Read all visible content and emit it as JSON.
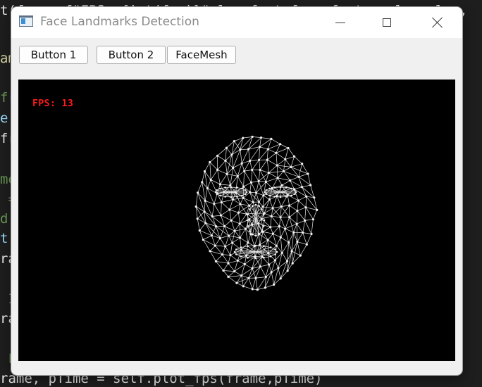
{
  "background_code": {
    "lines": [
      {
        "spans": [
          {
            "text": "t(frame,f\"FPS: {int(fps)}\",loc,font_face,font_scale,color,",
            "cls": "c-white"
          }
        ]
      },
      {
        "spans": [
          {
            "text": "am",
            "cls": "c-yellow"
          }
        ]
      },
      {
        "spans": [
          {
            "text": "fr",
            "cls": "c-green"
          }
        ]
      },
      {
        "spans": [
          {
            "text": "e:",
            "cls": "c-cyan"
          }
        ]
      },
      {
        "spans": [
          {
            "text": "fr",
            "cls": "c-white"
          }
        ]
      },
      {
        "spans": [
          {
            "text": "me",
            "cls": "c-green"
          }
        ]
      },
      {
        "spans": [
          {
            "text": " =",
            "cls": "c-green"
          }
        ]
      },
      {
        "spans": [
          {
            "text": "d",
            "cls": "c-green"
          }
        ]
      },
      {
        "spans": [
          {
            "text": "t:",
            "cls": "c-cyan"
          }
        ]
      },
      {
        "spans": [
          {
            "text": "ra",
            "cls": "c-white"
          }
        ]
      },
      {
        "spans": [
          {
            "text": " I",
            "cls": "c-green"
          }
        ]
      },
      {
        "spans": [
          {
            "text": "ra",
            "cls": "c-white"
          }
        ]
      },
      {
        "spans": [
          {
            "text": " F",
            "cls": "c-green"
          }
        ]
      },
      {
        "spans": [
          {
            "text": "rame, pTime = self.plot_fps(frame,pTime)",
            "cls": "c-white"
          }
        ]
      }
    ]
  },
  "window": {
    "title": "Face Landmarks Detection",
    "icon": "app-window-icon",
    "controls": {
      "minimize": "minimize-icon",
      "maximize": "maximize-icon",
      "close": "close-icon"
    }
  },
  "toolbar": {
    "button1_label": "Button 1",
    "button2_label": "Button 2",
    "button3_label": "FaceMesh"
  },
  "video": {
    "fps_text": "FPS: 13",
    "fps_color": "#ff1a1a",
    "content": "face-mesh-landmarks"
  }
}
